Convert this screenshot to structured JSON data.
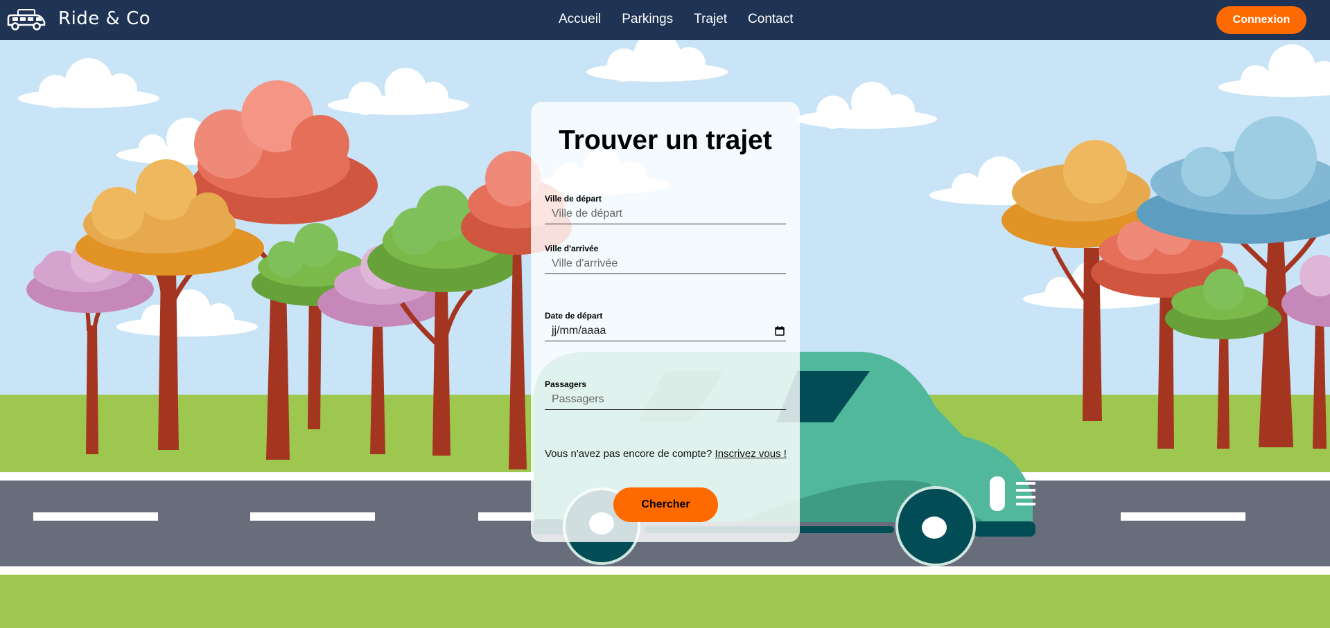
{
  "nav": {
    "brand": "Ride & Co",
    "links": [
      "Accueil",
      "Parkings",
      "Trajet",
      "Contact"
    ],
    "login_label": "Connexion"
  },
  "form": {
    "title": "Trouver un trajet",
    "departure_label": "Ville de départ",
    "departure_placeholder": "Ville de départ",
    "arrival_label": "Ville d'arrivée",
    "arrival_placeholder": "Ville d'arrivée",
    "date_label": "Date de départ",
    "date_placeholder": "jj/mm/aaaa",
    "passengers_label": "Passagers",
    "passengers_placeholder": "Passagers",
    "signup_text": "Vous n'avez pas encore de compte? ",
    "signup_link": "Inscrivez vous !",
    "search_label": "Chercher"
  },
  "colors": {
    "navbar": "#1f3354",
    "accent": "#ff6a00",
    "sky": "#c8e4f6",
    "grass": "#9dc74e",
    "road": "#676d7b",
    "van": "#52b89c"
  },
  "icons": {
    "logo": "van-logo-icon",
    "date_picker": "calendar-icon"
  }
}
